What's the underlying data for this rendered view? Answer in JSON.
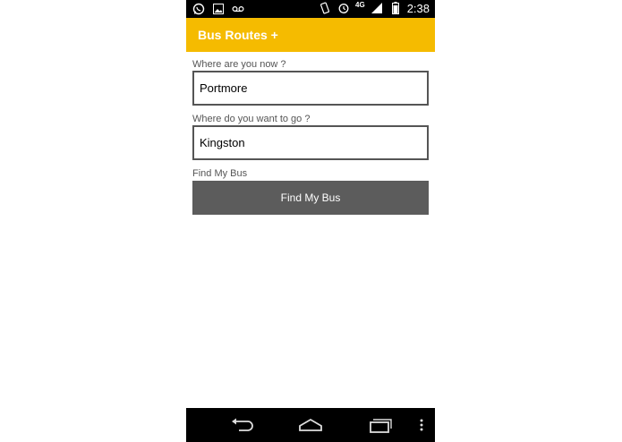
{
  "status_bar": {
    "network": "4G",
    "time": "2:38",
    "icons": [
      "whatsapp-icon",
      "image-icon",
      "voicemail-icon",
      "vibrate-icon",
      "alarm-icon",
      "signal-icon",
      "battery-icon"
    ]
  },
  "app": {
    "title": "Bus Routes +",
    "accent_color": "#f5bb00"
  },
  "form": {
    "origin_label": "Where are you now ?",
    "origin_value": "Portmore",
    "destination_label": "Where do you want to go ?",
    "destination_value": "Kingston",
    "find_label": "Find My Bus",
    "find_button": "Find My Bus",
    "button_color": "#5c5c5c"
  },
  "nav_bar": {
    "icons": [
      "back-icon",
      "home-icon",
      "recent-apps-icon",
      "overflow-menu-icon"
    ]
  }
}
